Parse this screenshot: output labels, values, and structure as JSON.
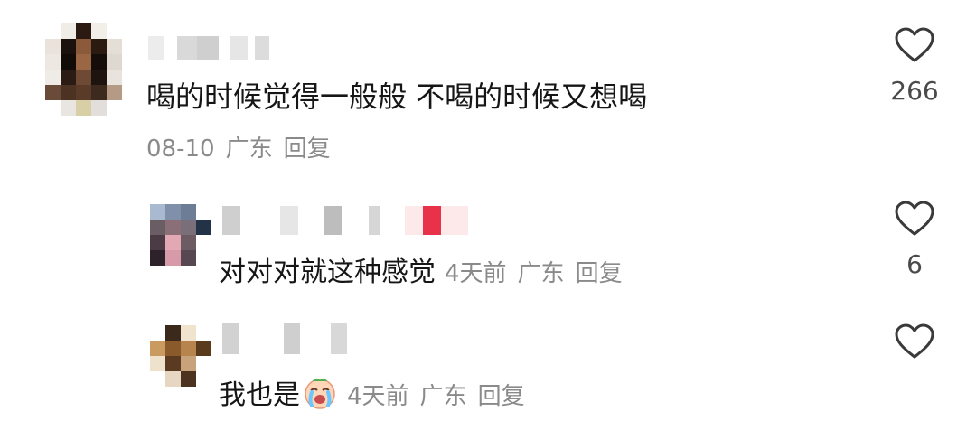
{
  "comments": [
    {
      "text": "喝的时候觉得一般般 不喝的时候又想喝",
      "date": "08-10",
      "region": "广东",
      "reply_label": "回复",
      "likes": "266",
      "avatar_pixels": [
        "#ffffff",
        "#f0ece6",
        "#2b1a12",
        "#f2efe9",
        "#ffffff",
        "#e9e3dc",
        "#1b120d",
        "#8b5a3a",
        "#2a1a12",
        "#e4ded7",
        "#ede8e2",
        "#120c09",
        "#9a6644",
        "#140d0a",
        "#ded8d1",
        "#efebe6",
        "#2a1c14",
        "#6e4a34",
        "#1e130e",
        "#e8e3dd",
        "#6a4a38",
        "#4b3223",
        "#5a3a28",
        "#3d2a1f",
        "#b59a86",
        "#ffffff",
        "#e9e5e1",
        "#d8cfa6",
        "#e2dedb",
        "#ffffff"
      ],
      "username_blocks": [
        "#ececec",
        "#ffffff",
        "#d9d9d9",
        "#cfcfcf",
        "#ffffff",
        "#e6e6e6",
        "#ffffff",
        "#dcdcdc"
      ]
    },
    {
      "text": "对对对就这种感觉",
      "time": "4天前",
      "region": "广东",
      "reply_label": "回复",
      "likes": "6",
      "avatar_pixels": [
        "#a9b9d0",
        "#8090aa",
        "#6d7d95",
        "#ffffff",
        "#6b5d64",
        "#8a6f78",
        "#7a6f78",
        "#223347",
        "#4a3b44",
        "#e2a9b5",
        "#6c5b62",
        "#ffffff",
        "#2d222a",
        "#d79aa8",
        "#574750",
        "#ffffff"
      ],
      "username_blocks": [
        "#cfcfcf",
        "#ffffff",
        "#e6e6e6",
        "#ffffff",
        "#bdbdbd",
        "#ffffff",
        "#d6d6d6",
        "#ffffff",
        "#fde8ea",
        "#e8324a",
        "#fde8ea"
      ]
    },
    {
      "text": "我也是",
      "time": "4天前",
      "region": "广东",
      "reply_label": "回复",
      "likes": "",
      "avatar_pixels": [
        "#ffffff",
        "#3b2a1c",
        "#f1e4cf",
        "#ffffff",
        "#c99b61",
        "#8a5a2a",
        "#b8844d",
        "#5a3a1d",
        "#efe2cc",
        "#5a3b22",
        "#c8a27a",
        "#ffffff",
        "#ffffff",
        "#e7d6c2",
        "#4b3320",
        "#ffffff"
      ],
      "username_blocks": [
        "#d2d2d2",
        "#ffffff",
        "#ffffff",
        "#cfcfcf",
        "#ffffff",
        "#d8d8d8"
      ],
      "emoji_name": "crying-face-emoji-icon"
    }
  ],
  "colors": {
    "text_primary": "#161616",
    "text_secondary": "#8a8a8a",
    "like_count": "#4a4a4a",
    "heart_outline": "#3a3a3a"
  }
}
